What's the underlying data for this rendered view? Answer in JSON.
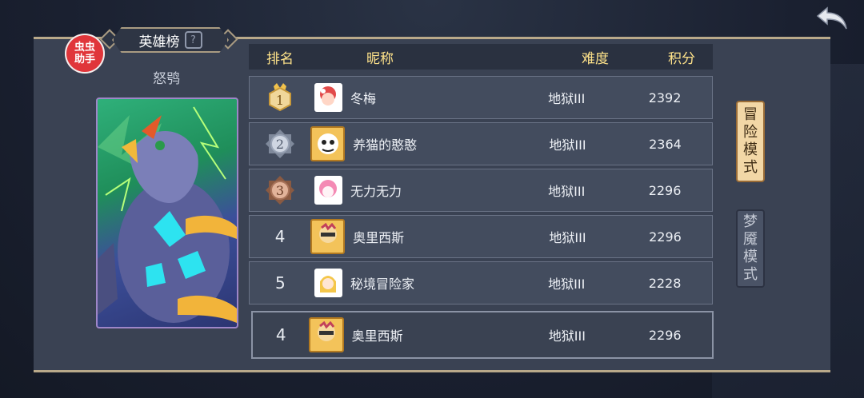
{
  "title": "英雄榜",
  "helper_badge": "虫虫\n助手",
  "hero_name": "怒鸮",
  "table": {
    "headers": {
      "rank": "排名",
      "nickname": "昵称",
      "difficulty": "难度",
      "score": "积分"
    },
    "rows": [
      {
        "rank": "1",
        "nickname": "冬梅",
        "difficulty": "地狱III",
        "score": "2392",
        "medal": "gold"
      },
      {
        "rank": "2",
        "nickname": "养猫的憨憨",
        "difficulty": "地狱III",
        "score": "2364",
        "medal": "silver"
      },
      {
        "rank": "3",
        "nickname": "无力无力",
        "difficulty": "地狱III",
        "score": "2296",
        "medal": "bronze"
      },
      {
        "rank": "4",
        "nickname": "奥里西斯",
        "difficulty": "地狱III",
        "score": "2296",
        "medal": "none"
      },
      {
        "rank": "5",
        "nickname": "秘境冒险家",
        "difficulty": "地狱III",
        "score": "2228",
        "medal": "none"
      }
    ],
    "my_row": {
      "rank": "4",
      "nickname": "奥里西斯",
      "difficulty": "地狱III",
      "score": "2296"
    }
  },
  "tabs": [
    {
      "label": "冒险模式",
      "active": true
    },
    {
      "label": "梦魇模式",
      "active": false
    }
  ],
  "icons": {
    "back": "back-arrow-icon",
    "help": "question-icon"
  },
  "colors": {
    "accent_gold": "#ffe38a",
    "panel": "#3a4253",
    "row": "#434c5e",
    "active_tab": "#f2d7a6"
  }
}
